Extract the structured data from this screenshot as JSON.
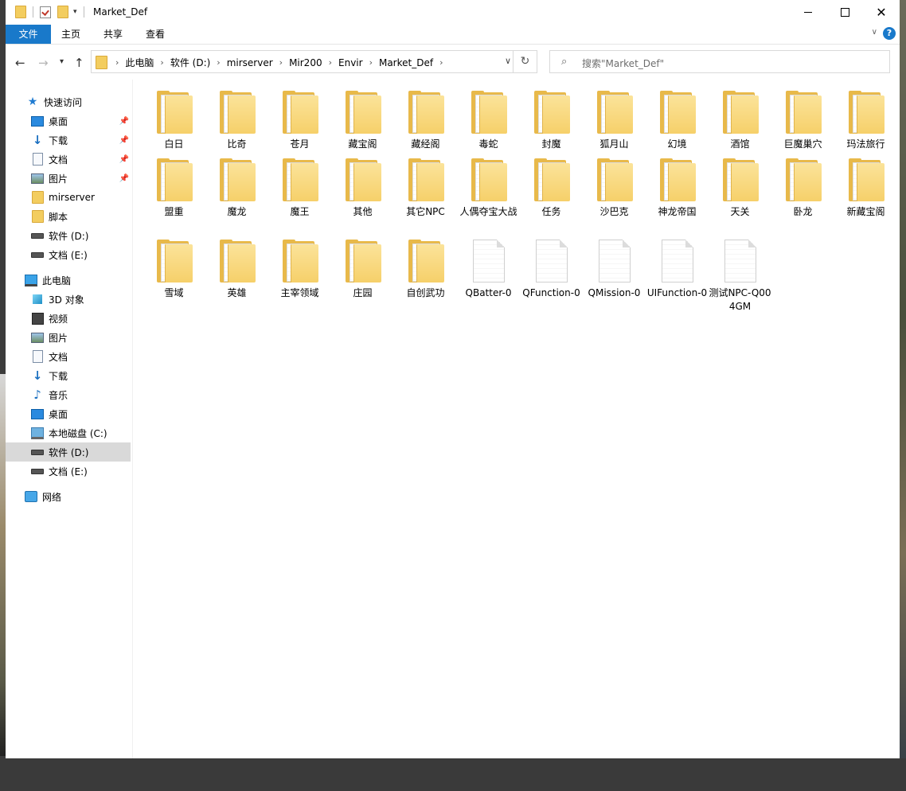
{
  "window": {
    "title": "Market_Def"
  },
  "ribbon": {
    "tabs": [
      "文件",
      "主页",
      "共享",
      "查看"
    ],
    "help": "?"
  },
  "address": {
    "crumbs": [
      "此电脑",
      "软件 (D:)",
      "mirserver",
      "Mir200",
      "Envir",
      "Market_Def"
    ]
  },
  "search": {
    "placeholder": "搜索\"Market_Def\""
  },
  "sidebar": {
    "quick_access": "快速访问",
    "quick_items": [
      "桌面",
      "下载",
      "文档",
      "图片",
      "mirserver",
      "脚本",
      "软件 (D:)",
      "文档 (E:)"
    ],
    "this_pc": "此电脑",
    "pc_items": [
      "3D 对象",
      "视频",
      "图片",
      "文档",
      "下载",
      "音乐",
      "桌面",
      "本地磁盘 (C:)",
      "软件 (D:)",
      "文档 (E:)"
    ],
    "network": "网络"
  },
  "files": {
    "row1": [
      "白日",
      "比奇",
      "苍月",
      "藏宝阁",
      "藏经阁",
      "毒蛇",
      "封魔",
      "狐月山",
      "幻境",
      "酒馆",
      "巨魔巢穴",
      "玛法旅行"
    ],
    "row2": [
      "盟重",
      "魔龙",
      "魔王",
      "其他",
      "其它NPC",
      "人偶夺宝大战",
      "任务",
      "沙巴克",
      "神龙帝国",
      "天关",
      "卧龙",
      "新藏宝阁"
    ],
    "row3_folders": [
      "雪域",
      "英雄",
      "主宰领域",
      "庄园",
      "自创武功"
    ],
    "row3_files": [
      "QBatter-0",
      "QFunction-0",
      "QMission-0",
      "UIFunction-0",
      "测试NPC-Q004GM"
    ]
  }
}
